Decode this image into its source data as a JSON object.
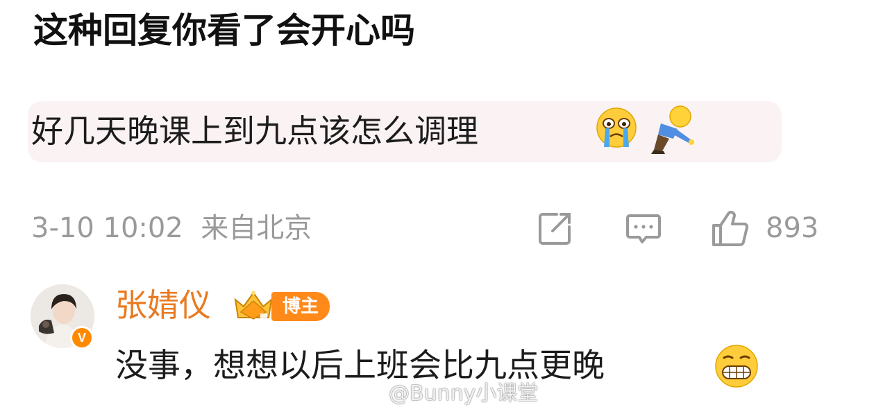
{
  "post": {
    "title": "这种回复你看了会开心吗"
  },
  "comment": {
    "text": "好几天晚课上到九点该怎么调理",
    "emojis": [
      "crying-face-icon",
      "kneeling-figure-icon"
    ],
    "timestamp": "3-10 10:02",
    "location": "来自北京",
    "like_count": "893",
    "actions": [
      "share-icon",
      "comment-icon",
      "like-icon"
    ]
  },
  "reply": {
    "username": "张婧仪",
    "verified_badge": "V",
    "author_badge": "博主",
    "text": "没事，想想以后上班会比九点更晚",
    "emoji": "grinning-face-icon"
  },
  "watermark": {
    "text": "@Bunny小课堂",
    "icon": "weibo-logo-icon"
  },
  "colors": {
    "username": "#ea7a20",
    "badge": "#ff8a1a",
    "muted": "#9a9a9a",
    "quote_bg": "#fbf2f4"
  }
}
